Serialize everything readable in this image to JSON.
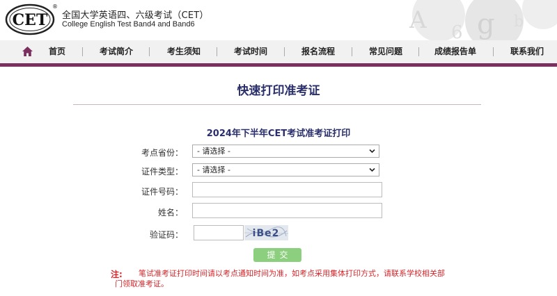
{
  "header": {
    "logo_text": "CET",
    "logo_reg": "®",
    "title_cn": "全国大学英语四、六级考试（CET）",
    "title_en": "College English Test Band4 and Band6"
  },
  "nav": {
    "items": [
      {
        "label": "首页"
      },
      {
        "label": "考试简介"
      },
      {
        "label": "考生须知"
      },
      {
        "label": "考试时间"
      },
      {
        "label": "报名流程"
      },
      {
        "label": "常见问题"
      },
      {
        "label": "成绩报告单"
      },
      {
        "label": "联系我们"
      }
    ]
  },
  "page": {
    "title": "快速打印准考证",
    "form_title": "2024年下半年CET考试准考证打印"
  },
  "form": {
    "province_label": "考点省份：",
    "province_value": "- 请选择 -",
    "idtype_label": "证件类型：",
    "idtype_value": "- 请选择 -",
    "idnumber_label": "证件号码：",
    "name_label": "姓名：",
    "captcha_label": "验证码：",
    "captcha_text": "iBe2",
    "submit_label": "提交"
  },
  "note": {
    "label": "注:",
    "text": "笔试准考证打印时间请以考点通知时间为准，如考点采用集体打印方式，请联系学校相关部门领取准考证。"
  },
  "colors": {
    "nav_accent": "#7b2f5f",
    "title_blue": "#2a2f6b",
    "submit_green": "#8ccf7e",
    "note_red": "#d8262b"
  }
}
